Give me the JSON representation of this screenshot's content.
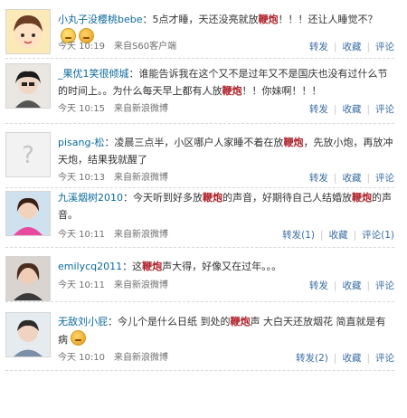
{
  "posts": [
    {
      "user": "小丸子没樱桃bebe",
      "text_a": "：5点才睡，天还没亮就放",
      "keyword": "鞭炮",
      "text_b": "！！！还让人睡觉不？",
      "time": "今天 10:19",
      "source": "来自S60客户端",
      "repost": "转发",
      "fav": "收藏",
      "comment": "评论",
      "emoji": [
        "smile-face-icon",
        "angry-face-icon"
      ]
    },
    {
      "user": "_果优1笑很倾城",
      "text_a": "：谁能告诉我在这个又不是过年又不是国庆也没有过什么节的时间上。。为什么每天早上都有人放",
      "keyword": "鞭炮",
      "text_b": "！！你妹啊！！！",
      "time": "今天 10:15",
      "source": "来自新浪微博",
      "repost": "转发",
      "fav": "收藏",
      "comment": "评论"
    },
    {
      "user": "pisang-松",
      "text_a": "：凌晨三点半，小区哪户人家睡不着在放",
      "keyword": "鞭炮",
      "text_b": "，先放小炮，再放冲天炮，结果我就醒了",
      "time": "今天 10:13",
      "source": "来自新浪微博",
      "repost": "转发",
      "fav": "收藏",
      "comment": "评论"
    },
    {
      "user": "九溪烟树2010",
      "text_a": "：今天听到好多放",
      "keyword": "鞭炮",
      "text_mid": "的声音，好期待自己人结婚放",
      "keyword2": "鞭炮",
      "text_b": "的声音。",
      "time": "今天 10:11",
      "source": "来自新浪微博",
      "repost": "转发(1)",
      "fav": "收藏",
      "comment": "评论(1)"
    },
    {
      "user": "emilycq2011",
      "text_a": "：这",
      "keyword": "鞭炮",
      "text_b": "声大得，好像又在过年。。。",
      "time": "今天 10:11",
      "source": "来自新浪微博",
      "repost": "转发",
      "fav": "收藏",
      "comment": "评论"
    },
    {
      "user": "无敌刘小屁",
      "text_a": "：今儿个是什么日纸 到处的",
      "keyword": "鞭炮",
      "text_b": "声 大白天还放烟花 简直就是有病",
      "time": "今天 10:10",
      "source": "来自新浪微博",
      "repost": "转发(2)",
      "fav": "收藏",
      "comment": "评论",
      "emoji": [
        "angry-face-icon"
      ]
    }
  ],
  "colors": {
    "link": "#0a6a9c",
    "keyword": "#b0222a",
    "action": "#3b6ea3"
  }
}
